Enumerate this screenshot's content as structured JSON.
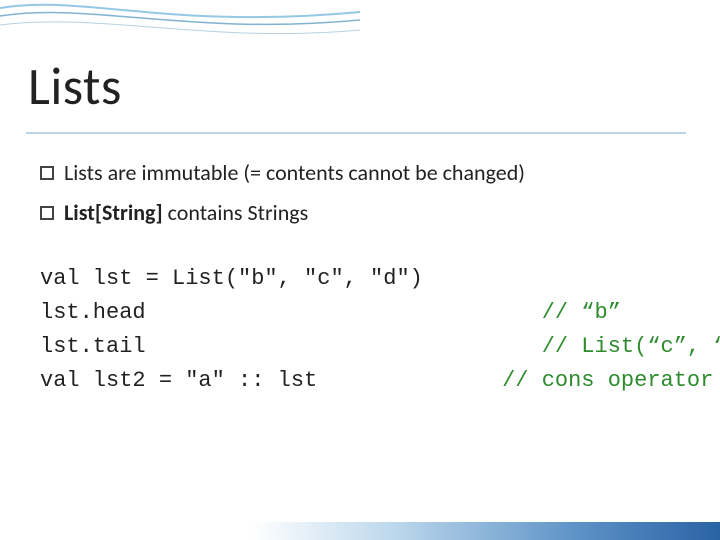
{
  "title": "Lists",
  "bullets": [
    {
      "pre": "Lists are immutable (= contents cannot be changed)",
      "bold": ""
    },
    {
      "pre": "",
      "bold": "List[String]",
      "post": " contains Strings"
    }
  ],
  "code": {
    "l1a": "val lst = List(\"b\", \"c\", \"d\")",
    "l2a": "lst.head",
    "l2c": "// “b”",
    "l3a": "lst.tail",
    "l3c": "// List(“c”, “d”)",
    "l4a": "val lst2 = \"a\" :: lst",
    "l4c": "// cons operator",
    "pad": "                              "
  },
  "chart_data": null
}
